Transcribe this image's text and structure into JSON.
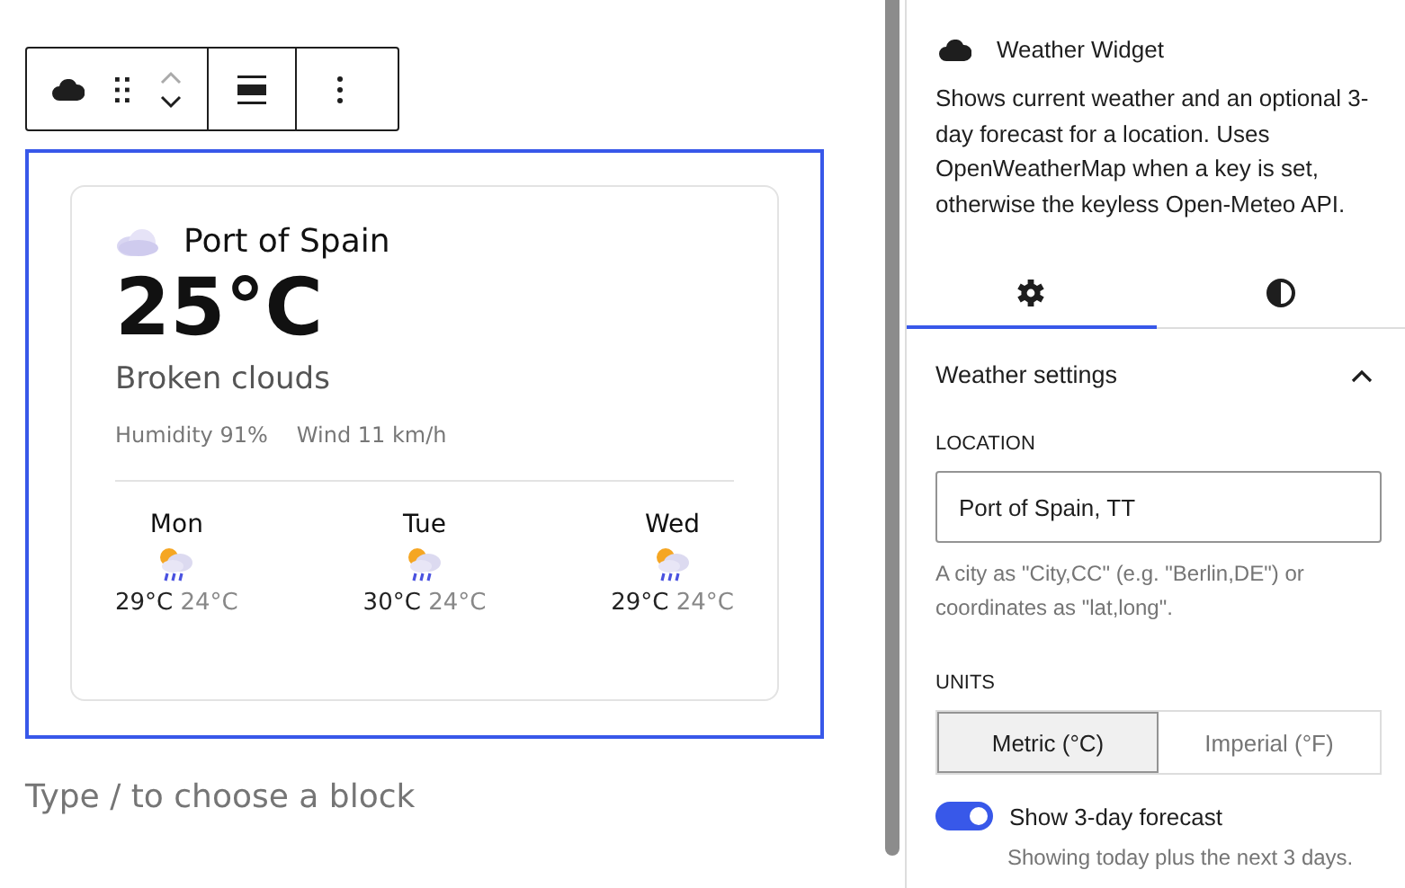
{
  "weather_card": {
    "location": "Port of Spain",
    "temperature": "25°C",
    "condition": "Broken clouds",
    "humidity": "Humidity 91%",
    "wind": "Wind 11 km/h",
    "forecast": [
      {
        "day": "Mon",
        "high": "29°C",
        "low": "24°C"
      },
      {
        "day": "Tue",
        "high": "30°C",
        "low": "24°C"
      },
      {
        "day": "Wed",
        "high": "29°C",
        "low": "24°C"
      }
    ]
  },
  "editor": {
    "placeholder": "Type / to choose a block"
  },
  "sidebar": {
    "block_title": "Weather Widget",
    "description": "Shows current weather and an optional 3-day forecast for a location. Uses OpenWeatherMap when a key is set, otherwise the keyless Open-Meteo API.",
    "tabs": [
      {
        "kind": "settings",
        "selected": true
      },
      {
        "kind": "styles",
        "selected": false
      }
    ],
    "panel": {
      "title": "Weather settings",
      "expanded": true,
      "location_label": "LOCATION",
      "location_value": "Port of Spain, TT",
      "location_help": "A city as \"City,CC\" (e.g. \"Berlin,DE\") or coordinates as \"lat,long\".",
      "units_label": "UNITS",
      "units": [
        {
          "label": "Metric (°C)",
          "selected": true
        },
        {
          "label": "Imperial (°F)",
          "selected": false
        }
      ],
      "forecast_toggle": {
        "label": "Show 3-day forecast",
        "on": true,
        "help": "Showing today plus the next 3 days."
      }
    }
  }
}
